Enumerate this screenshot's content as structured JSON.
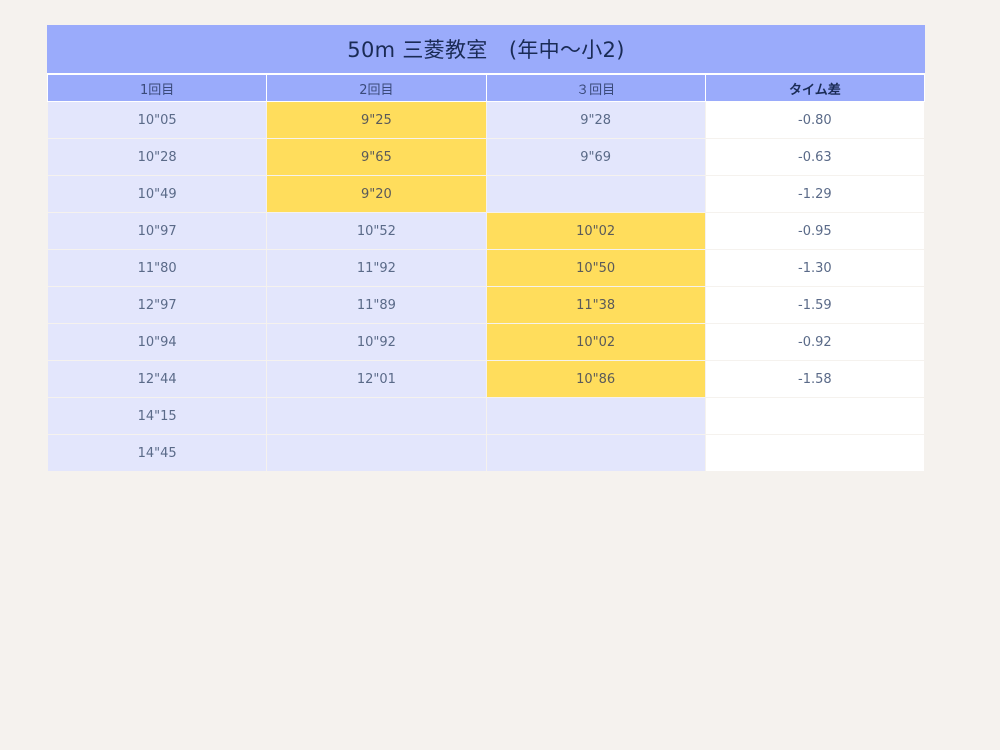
{
  "title": "50m 三菱教室　(年中〜小2)",
  "headers": [
    "1回目",
    "2回目",
    "３回目",
    "タイム差"
  ],
  "rows": [
    {
      "r1": "10\"05",
      "r2": "9\"25",
      "r3": "9\"28",
      "diff": "-0.80",
      "best": 2
    },
    {
      "r1": "10\"28",
      "r2": "9\"65",
      "r3": "9\"69",
      "diff": "-0.63",
      "best": 2
    },
    {
      "r1": "10\"49",
      "r2": "9\"20",
      "r3": "",
      "diff": "-1.29",
      "best": 2
    },
    {
      "r1": "10\"97",
      "r2": "10\"52",
      "r3": "10\"02",
      "diff": "-0.95",
      "best": 3
    },
    {
      "r1": "11\"80",
      "r2": "11\"92",
      "r3": "10\"50",
      "diff": "-1.30",
      "best": 3
    },
    {
      "r1": "12\"97",
      "r2": "11\"89",
      "r3": "11\"38",
      "diff": "-1.59",
      "best": 3
    },
    {
      "r1": "10\"94",
      "r2": "10\"92",
      "r3": "10\"02",
      "diff": "-0.92",
      "best": 3
    },
    {
      "r1": "12\"44",
      "r2": "12\"01",
      "r3": "10\"86",
      "diff": "-1.58",
      "best": 3
    },
    {
      "r1": "14\"15",
      "r2": "",
      "r3": "",
      "diff": "",
      "best": 0
    },
    {
      "r1": "14\"45",
      "r2": "",
      "r3": "",
      "diff": "",
      "best": 0
    }
  ],
  "colors": {
    "header": "#9aabfb",
    "cell": "#e3e6fc",
    "best": "#ffdd5c",
    "diff_cell": "#ffffff"
  }
}
